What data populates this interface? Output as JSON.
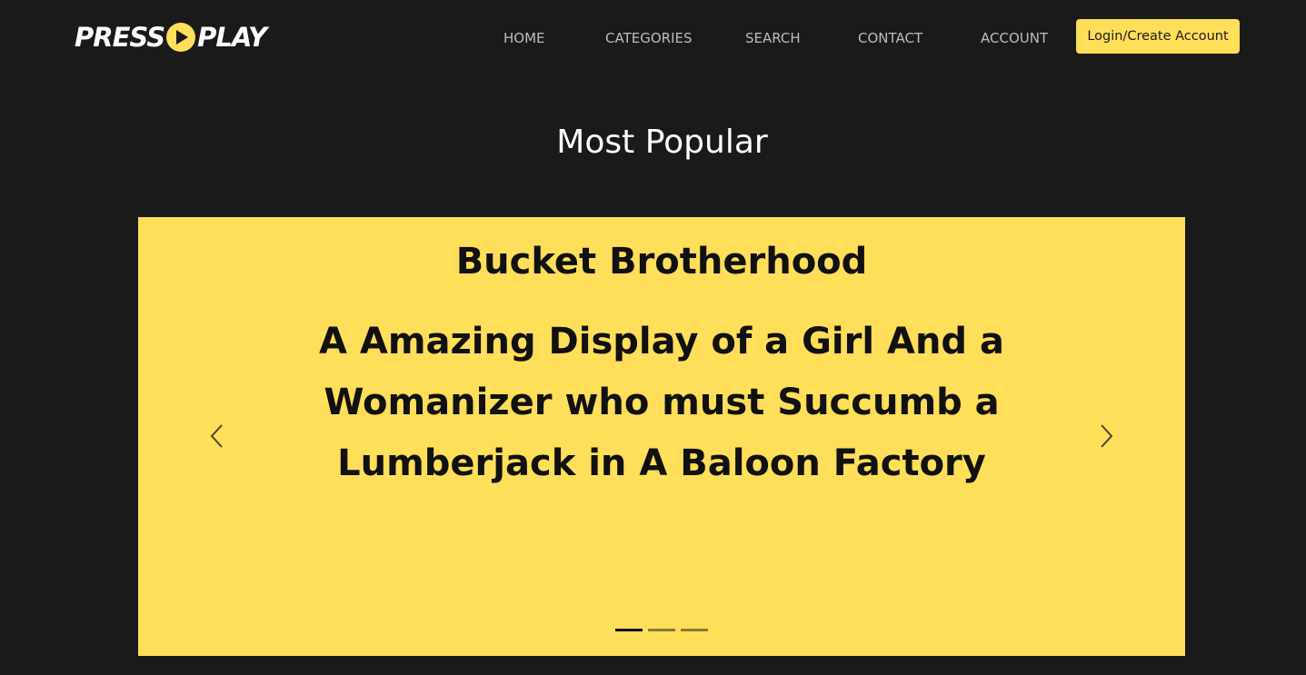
{
  "logo": {
    "press": "PRESS",
    "play": "PLAY"
  },
  "nav": {
    "items": [
      {
        "label": "HOME"
      },
      {
        "label": "CATEGORIES"
      },
      {
        "label": "SEARCH"
      },
      {
        "label": "CONTACT"
      },
      {
        "label": "ACCOUNT"
      }
    ],
    "login_label": "Login/Create Account"
  },
  "section": {
    "title": "Most Popular"
  },
  "carousel": {
    "slide": {
      "title": "Bucket Brotherhood",
      "description": "A Amazing Display of a Girl And a Womanizer who must Succumb a Lumberjack in A Baloon Factory"
    },
    "indicator_count": 3,
    "active_indicator": 1
  },
  "colors": {
    "background": "#1b1a1a",
    "accent": "#ffde5a",
    "text_dark": "#111111",
    "nav_text": "#bdbdbd"
  },
  "icons": {
    "logo_play": "play-circle-icon",
    "prev": "chevron-left-icon",
    "next": "chevron-right-icon"
  }
}
